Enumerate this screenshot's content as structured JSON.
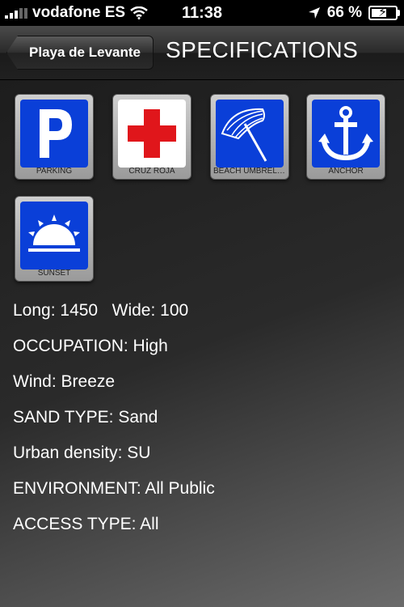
{
  "status": {
    "carrier": "vodafone ES",
    "time": "11:38",
    "battery": "66 %",
    "battery_level": 0.66
  },
  "nav": {
    "back_label": "Playa de Levante",
    "title": "SPECIFICATIONS"
  },
  "tiles": [
    {
      "label": "PARKING",
      "icon": "parking-icon"
    },
    {
      "label": "CRUZ ROJA",
      "icon": "red-cross-icon"
    },
    {
      "label": "BEACH UMBRELL...",
      "icon": "beach-umbrella-icon"
    },
    {
      "label": "ANCHOR",
      "icon": "anchor-icon"
    },
    {
      "label": "SUNSET",
      "icon": "sunset-icon"
    }
  ],
  "specs": {
    "length": "Long: 1450",
    "width": "Wide: 100",
    "occupation": "OCCUPATION: High",
    "wind": "Wind: Breeze",
    "sand": "SAND TYPE: Sand",
    "urban": "Urban density: SU",
    "environment": "ENVIRONMENT: All Public",
    "access": "ACCESS TYPE: All"
  },
  "colors": {
    "tile_blue": "#0a3fd8",
    "cross_red": "#e0161b"
  }
}
